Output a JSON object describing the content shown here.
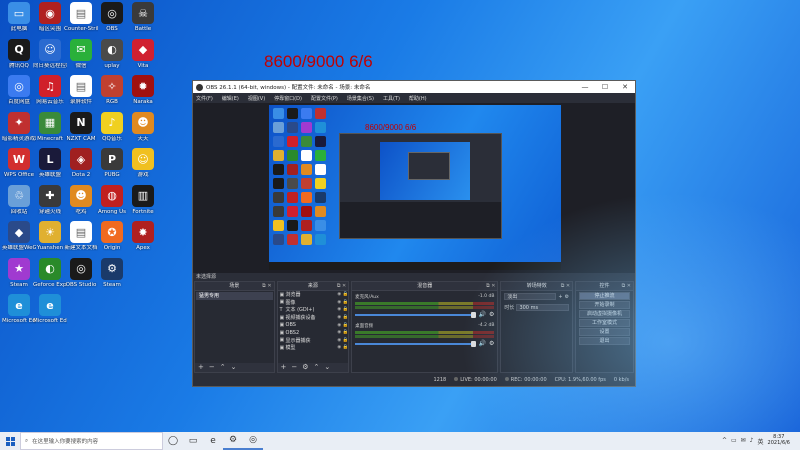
{
  "overlay_text": "8600/9000 6/6",
  "desktop_icons": [
    {
      "label": "此电脑",
      "color": "#3a8ee6",
      "glyph": "▭",
      "icon": "computer-icon"
    },
    {
      "label": "腾讯QQ",
      "color": "#1a1a1a",
      "glyph": "Q",
      "icon": "qq-icon"
    },
    {
      "label": "百度网盘",
      "color": "#3b7bf0",
      "glyph": "◎",
      "icon": "cloud-icon"
    },
    {
      "label": "暗影精灵游戏助手",
      "color": "#c03030",
      "glyph": "✦",
      "icon": "game-icon"
    },
    {
      "label": "WPS Office",
      "color": "#d22f2f",
      "glyph": "W",
      "icon": "wps-icon"
    },
    {
      "label": "回收站",
      "color": "#6a9fd8",
      "glyph": "♲",
      "icon": "recycle-bin-icon"
    },
    {
      "label": "英雄联盟WeGame",
      "color": "#2a4a8a",
      "glyph": "◆",
      "icon": "wegame-icon"
    },
    {
      "label": "Steam",
      "color": "#a03ad0",
      "glyph": "★",
      "icon": "app-icon"
    },
    {
      "label": "Microsoft Edge",
      "color": "#1f8fd8",
      "glyph": "e",
      "icon": "edge-icon"
    },
    {
      "label": "暗区突围",
      "color": "#b02020",
      "glyph": "◉",
      "icon": "game-icon"
    },
    {
      "label": "向日葵远程控制",
      "color": "#2a6ad0",
      "glyph": "☺",
      "icon": "remote-icon"
    },
    {
      "label": "网易云音乐",
      "color": "#d0202a",
      "glyph": "♫",
      "icon": "music-icon"
    },
    {
      "label": "Minecraft",
      "color": "#3a8a3a",
      "glyph": "▦",
      "icon": "game-icon"
    },
    {
      "label": "英雄联盟",
      "color": "#1a1a3a",
      "glyph": "L",
      "icon": "lol-icon"
    },
    {
      "label": "穿越火线",
      "color": "#3a3a3a",
      "glyph": "✚",
      "icon": "game-icon"
    },
    {
      "label": "Yuanshen",
      "color": "#e0b030",
      "glyph": "☀",
      "icon": "game-icon"
    },
    {
      "label": "Geforce Experience",
      "color": "#2a8a2a",
      "glyph": "◐",
      "icon": "nvidia-icon"
    },
    {
      "label": "Microsoft Edge",
      "color": "#1f8fd8",
      "glyph": "e",
      "icon": "edge-icon"
    },
    {
      "label": "Counter-Strike",
      "color": "#ffffff",
      "glyph": "▤",
      "icon": "file-icon"
    },
    {
      "label": "微信",
      "color": "#2ab03a",
      "glyph": "✉",
      "icon": "wechat-icon"
    },
    {
      "label": "录屏软件",
      "color": "#ffffff",
      "glyph": "▤",
      "icon": "file-icon"
    },
    {
      "label": "NZXT CAM",
      "color": "#1a1a1a",
      "glyph": "N",
      "icon": "nzxt-icon"
    },
    {
      "label": "Dota 2",
      "color": "#a02020",
      "glyph": "◈",
      "icon": "game-icon"
    },
    {
      "label": "吃鸡",
      "color": "#e08a20",
      "glyph": "☻",
      "icon": "game-icon"
    },
    {
      "label": "新建文本文档",
      "color": "#ffffff",
      "glyph": "▤",
      "icon": "file-icon"
    },
    {
      "label": "OBS Studio",
      "color": "#1a1a1a",
      "glyph": "◎",
      "icon": "obs-icon"
    },
    {
      "label": "OBS",
      "color": "#1a1a1a",
      "glyph": "◎",
      "icon": "obs-icon"
    },
    {
      "label": "uplay",
      "color": "#4a4a4a",
      "glyph": "◐",
      "icon": "game-icon"
    },
    {
      "label": "RGB",
      "color": "#c04030",
      "glyph": "✧",
      "icon": "game-icon"
    },
    {
      "label": "QQ音乐",
      "color": "#f0d020",
      "glyph": "♪",
      "icon": "music-icon"
    },
    {
      "label": "PUBG",
      "color": "#3a3a3a",
      "glyph": "P",
      "icon": "pubg-icon"
    },
    {
      "label": "Among Us",
      "color": "#c02020",
      "glyph": "◍",
      "icon": "game-icon"
    },
    {
      "label": "Origin",
      "color": "#f06a20",
      "glyph": "✪",
      "icon": "origin-icon"
    },
    {
      "label": "Steam",
      "color": "#1a3a6a",
      "glyph": "⚙",
      "icon": "steam-icon"
    },
    {
      "label": "Battle",
      "color": "#3a3a3a",
      "glyph": "☠",
      "icon": "game-icon"
    },
    {
      "label": "Vita",
      "color": "#d02030",
      "glyph": "◆",
      "icon": "game-icon"
    },
    {
      "label": "Naraka",
      "color": "#a01010",
      "glyph": "✹",
      "icon": "game-icon"
    },
    {
      "label": "天天",
      "color": "#e08a20",
      "glyph": "☻",
      "icon": "game-icon"
    },
    {
      "label": "游戏",
      "color": "#f0c020",
      "glyph": "☺",
      "icon": "game-icon"
    },
    {
      "label": "Fortnite",
      "color": "#1a1a1a",
      "glyph": "▥",
      "icon": "game-icon"
    },
    {
      "label": "Apex",
      "color": "#b02020",
      "glyph": "✸",
      "icon": "game-icon"
    }
  ],
  "obs": {
    "title": "OBS 26.1.1 (64-bit, windows) - 配置文件: 未命名 - 场景: 未命名",
    "window_controls": [
      "—",
      "☐",
      "✕"
    ],
    "menu": [
      "文件(F)",
      "编辑(E)",
      "视图(V)",
      "停靠窗口(D)",
      "配置文件(P)",
      "场景集合(S)",
      "工具(T)",
      "帮助(H)"
    ],
    "nested_overlay_text": "8600/9000 6/6",
    "scene_label": "未选择源",
    "scenes": {
      "header": "场景",
      "items": [
        "猛男专用"
      ]
    },
    "sources": {
      "header": "来源",
      "items": [
        {
          "icon": "▣",
          "name": "浏览器",
          "flags": "◉ 🔒"
        },
        {
          "icon": "▣",
          "name": "图像",
          "flags": "◉ 🔒"
        },
        {
          "icon": "T",
          "name": "文本 (GDI+)",
          "flags": "◉ 🔒"
        },
        {
          "icon": "▣",
          "name": "视频捕获设备",
          "flags": "◉ 🔒"
        },
        {
          "icon": "▣",
          "name": "OBS",
          "flags": "◉ 🔒"
        },
        {
          "icon": "▣",
          "name": "OBS2",
          "flags": "◉ 🔒"
        },
        {
          "icon": "▣",
          "name": "显示器捕获",
          "flags": "◉ 🔒"
        },
        {
          "icon": "▣",
          "name": "模型",
          "flags": "◉ 🔒"
        }
      ]
    },
    "mixer": {
      "header": "混音器",
      "channels": [
        {
          "name": "麦克风/Aux",
          "db": "-1.0 dB"
        },
        {
          "name": "桌面音频",
          "db": "-4.2 dB"
        }
      ]
    },
    "transitions": {
      "header": "转场特效",
      "type": "淡出",
      "duration_label": "时长",
      "duration_value": "300 ms"
    },
    "controls": {
      "header": "控件",
      "buttons": [
        "停止推流",
        "开始录制",
        "启动虚拟摄像机",
        "工作室模式",
        "设置",
        "退出"
      ],
      "active_index": 0
    },
    "status": {
      "dropped": "1218",
      "live_time": "00:00:00",
      "rec_label": "REC:",
      "rec_time": "00:00:00",
      "cpu": "CPU: 1.9%,60.00 fps",
      "live_label": "LIVE:",
      "kbps": "0 kb/s"
    }
  },
  "taskbar": {
    "search_placeholder": "在这里输入你要搜索的内容",
    "apps": [
      {
        "glyph": "◯",
        "icon": "cortana-icon"
      },
      {
        "glyph": "▭",
        "icon": "task-view-icon"
      },
      {
        "glyph": "e",
        "icon": "edge-icon"
      },
      {
        "glyph": "⚙",
        "icon": "steam-icon"
      },
      {
        "glyph": "◎",
        "icon": "obs-icon"
      }
    ],
    "tray_icons": [
      "^",
      "▭",
      "✉",
      "♪",
      "英"
    ],
    "time": "8:37",
    "date": "2021/6/6"
  }
}
